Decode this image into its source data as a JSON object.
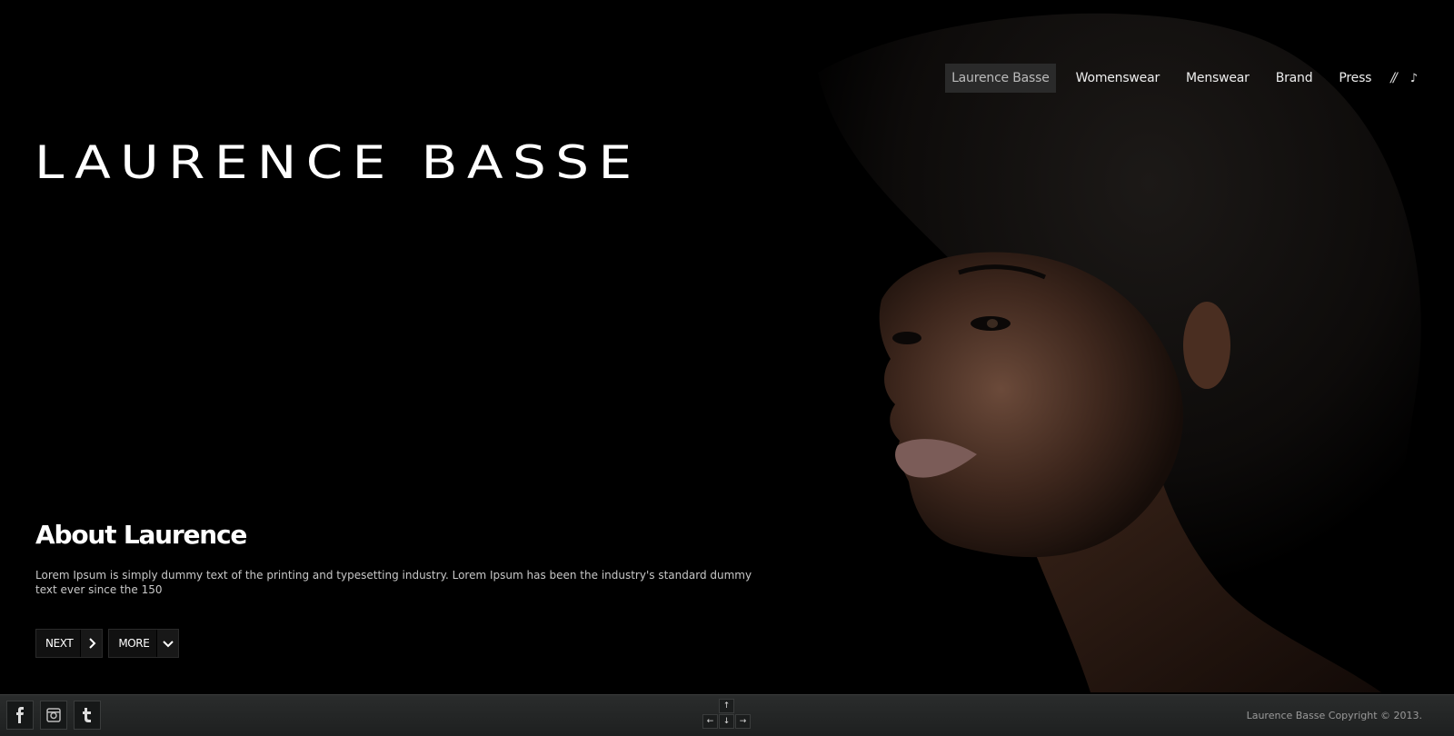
{
  "nav": {
    "items": [
      {
        "label": "Laurence Basse",
        "active": true
      },
      {
        "label": "Womenswear",
        "active": false
      },
      {
        "label": "Menswear",
        "active": false
      },
      {
        "label": "Brand",
        "active": false
      },
      {
        "label": "Press",
        "active": false
      }
    ],
    "separator": "//",
    "music_icon": "♪"
  },
  "logo": "LAURENCE BASSE",
  "hero": {
    "image": "portrait of a woman on black background"
  },
  "about": {
    "title": "About Laurence",
    "text": "Lorem Ipsum is simply dummy text of the printing and typesetting industry. Lorem Ipsum has been the industry's standard dummy text ever since the 150"
  },
  "buttons": {
    "next_label": "NEXT",
    "more_label": "MORE"
  },
  "footer": {
    "social": [
      "facebook-icon",
      "instagram-icon",
      "tumblr-icon"
    ],
    "arrows": {
      "up": "↑",
      "left": "←",
      "down": "↓",
      "right": "→"
    },
    "copyright": "Laurence Basse Copyright © 2013."
  },
  "colors": {
    "background": "#000000",
    "footer": "#252727",
    "nav_active_bg": "#2a2a2a"
  }
}
